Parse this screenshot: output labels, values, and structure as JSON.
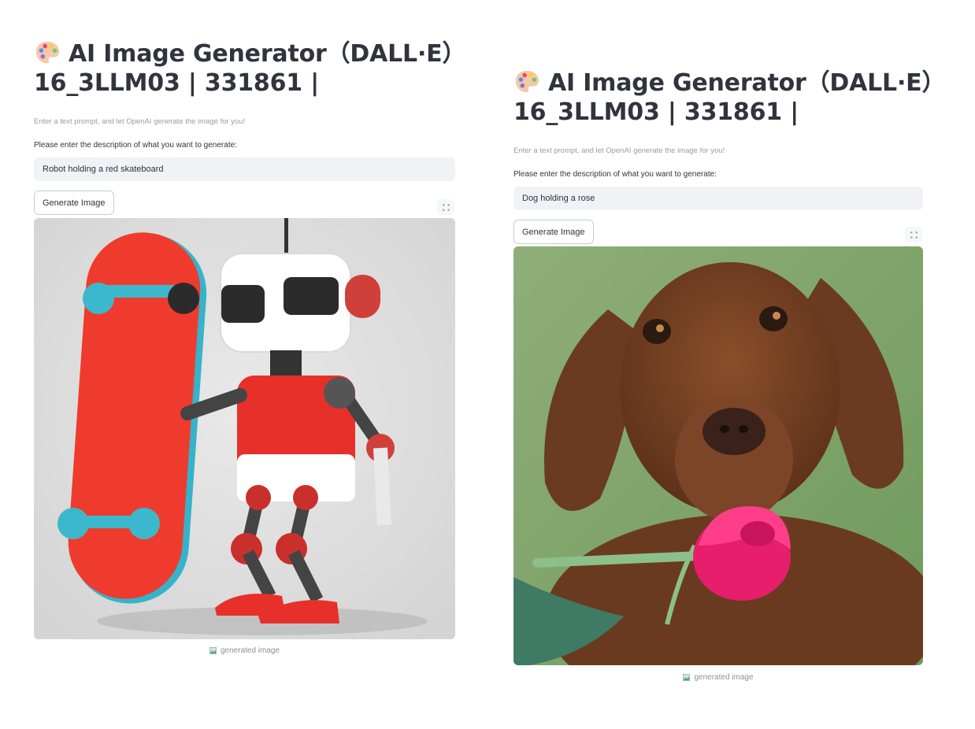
{
  "panels": [
    {
      "title_line1": "AI Image Generator（DALL·E）",
      "title_line2": "16_3LLM03 | 331861 |",
      "subtitle": "Enter a text prompt, and let OpenAI generate the image for you!",
      "input_label": "Please enter the description of what you want to generate:",
      "input_value": "Robot holding a red skateboard",
      "button_label": "Generate Image",
      "image_caption": "generated image"
    },
    {
      "title_line1": "AI Image Generator（DALL·E）",
      "title_line2": "16_3LLM03 | 331861 |",
      "subtitle": "Enter a text prompt, and let OpenAI generate the image for you!",
      "input_label": "Please enter the description of what you want to generate:",
      "input_value": "Dog holding a rose",
      "button_label": "Generate Image",
      "image_caption": "generated image"
    }
  ],
  "icons": {
    "title": "palette-icon",
    "fullscreen": "fullscreen-icon",
    "caption": "image-icon"
  }
}
